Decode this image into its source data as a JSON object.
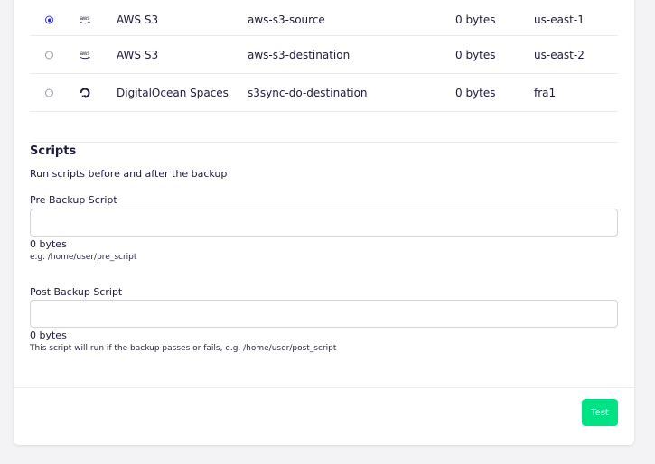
{
  "storage": {
    "rows": [
      {
        "selected": true,
        "icon": "aws-logo-icon",
        "icon_text": "aws",
        "provider": "AWS S3",
        "name": "aws-s3-source",
        "size": "0 bytes",
        "region": "us-east-1"
      },
      {
        "selected": false,
        "icon": "aws-logo-icon",
        "icon_text": "aws",
        "provider": "AWS S3",
        "name": "aws-s3-destination",
        "size": "0 bytes",
        "region": "us-east-2"
      },
      {
        "selected": false,
        "icon": "digitalocean-logo-icon",
        "provider": "DigitalOcean Spaces",
        "name": "s3sync-do-destination",
        "size": "0 bytes",
        "region": "fra1"
      }
    ]
  },
  "scripts": {
    "title": "Scripts",
    "description": "Run scripts before and after the backup",
    "pre": {
      "label": "Pre Backup Script",
      "value": "",
      "byte_count": "0 bytes",
      "hint": "e.g. /home/user/pre_script"
    },
    "post": {
      "label": "Post Backup Script",
      "value": "",
      "byte_count": "0 bytes",
      "hint": "This script will run if the backup passes or fails, e.g. /home/user/post_script"
    }
  },
  "actions": {
    "test_label": "Test",
    "test_color": "#00e384"
  },
  "colors": {
    "accent": "#2b2bd4",
    "text": "#1d1b3a"
  }
}
